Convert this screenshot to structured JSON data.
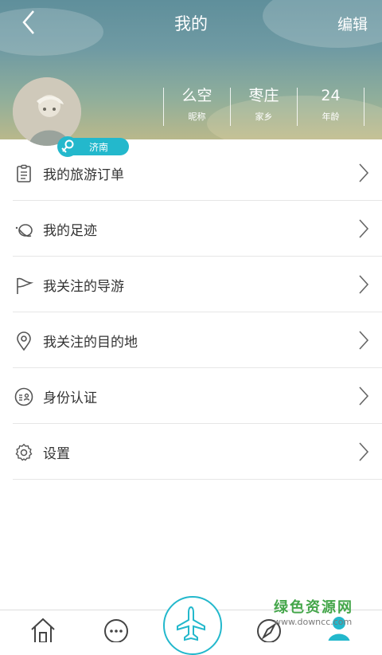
{
  "header": {
    "title": "我的",
    "edit_label": "编辑",
    "location_badge": "济南",
    "stats": [
      {
        "value": "么空",
        "label": "昵称"
      },
      {
        "value": "枣庄",
        "label": "家乡"
      },
      {
        "value": "24",
        "label": "年龄"
      }
    ]
  },
  "menu": [
    {
      "label": "我的旅游订单",
      "icon": "order-list-icon"
    },
    {
      "label": "我的足迹",
      "icon": "footprint-icon"
    },
    {
      "label": "我关注的导游",
      "icon": "flag-icon"
    },
    {
      "label": "我关注的目的地",
      "icon": "location-pin-icon"
    },
    {
      "label": "身份认证",
      "icon": "id-card-icon"
    },
    {
      "label": "设置",
      "icon": "gear-icon"
    }
  ],
  "bottom_nav": [
    "home-icon",
    "chat-icon",
    "airplane-icon",
    "compass-icon",
    "profile-icon"
  ],
  "watermark": {
    "title": "绿色资源网",
    "url": "www.downcc.com"
  },
  "colors": {
    "accent": "#23b8cc",
    "watermark": "#44a64a"
  }
}
